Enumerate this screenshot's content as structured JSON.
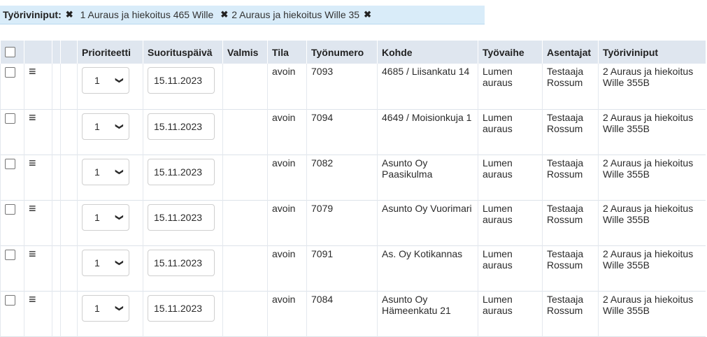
{
  "filter_bar": {
    "label": "Työriviniput:",
    "chips": [
      "1 Auraus ja hiekoitus 465 Wille",
      "2 Auraus ja hiekoitus Wille 35"
    ]
  },
  "table": {
    "headers": [
      "Prioriteetti",
      "Suorituspäivä",
      "Valmis",
      "Tila",
      "Työnumero",
      "Kohde",
      "Työvaihe",
      "Asentajat",
      "Työriviniput"
    ],
    "rows": [
      {
        "priority": "1",
        "date": "15.11.2023",
        "valmis": "",
        "tila": "avoin",
        "tyonumero": "7093",
        "kohde": "4685 / Liisankatu 14",
        "tyovaihe": "Lumen auraus",
        "asentajat": "Testaaja Rossum",
        "riviniput": "2 Auraus ja hiekoitus Wille 355B"
      },
      {
        "priority": "1",
        "date": "15.11.2023",
        "valmis": "",
        "tila": "avoin",
        "tyonumero": "7094",
        "kohde": "4649 / Moisionkuja 1",
        "tyovaihe": "Lumen auraus",
        "asentajat": "Testaaja Rossum",
        "riviniput": "2 Auraus ja hiekoitus Wille 355B"
      },
      {
        "priority": "1",
        "date": "15.11.2023",
        "valmis": "",
        "tila": "avoin",
        "tyonumero": "7082",
        "kohde": "Asunto Oy Paasikulma",
        "tyovaihe": "Lumen auraus",
        "asentajat": "Testaaja Rossum",
        "riviniput": "2 Auraus ja hiekoitus Wille 355B"
      },
      {
        "priority": "1",
        "date": "15.11.2023",
        "valmis": "",
        "tila": "avoin",
        "tyonumero": "7079",
        "kohde": "Asunto Oy Vuorimari",
        "tyovaihe": "Lumen auraus",
        "asentajat": "Testaaja Rossum",
        "riviniput": "2 Auraus ja hiekoitus Wille 355B"
      },
      {
        "priority": "1",
        "date": "15.11.2023",
        "valmis": "",
        "tila": "avoin",
        "tyonumero": "7091",
        "kohde": "As. Oy Kotikannas",
        "tyovaihe": "Lumen auraus",
        "asentajat": "Testaaja Rossum",
        "riviniput": "2 Auraus ja hiekoitus Wille 355B"
      },
      {
        "priority": "1",
        "date": "15.11.2023",
        "valmis": "",
        "tila": "avoin",
        "tyonumero": "7084",
        "kohde": "Asunto Oy Hämeenkatu 21",
        "tyovaihe": "Lumen auraus",
        "asentajat": "Testaaja Rossum",
        "riviniput": "2 Auraus ja hiekoitus Wille 355B"
      }
    ]
  }
}
